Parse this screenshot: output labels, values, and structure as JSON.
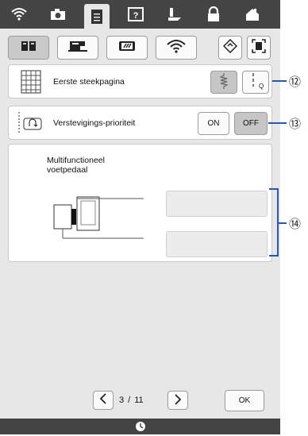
{
  "top_tabs": [
    {
      "icon": "wifi-icon",
      "active": false
    },
    {
      "icon": "camera-icon",
      "active": false
    },
    {
      "icon": "document-icon",
      "active": true
    },
    {
      "icon": "help-icon",
      "active": false
    },
    {
      "icon": "sewing-foot-icon",
      "active": false
    },
    {
      "icon": "lock-icon",
      "active": false
    },
    {
      "icon": "home-icon",
      "active": false
    }
  ],
  "sub_tabs": [
    {
      "icon": "book-icon",
      "selected": true
    },
    {
      "icon": "sewing-machine-icon",
      "selected": false
    },
    {
      "icon": "embroidery-frame-icon",
      "selected": false
    },
    {
      "icon": "wifi-icon",
      "selected": false
    },
    {
      "icon": "diamond-settings-icon",
      "selected": false
    },
    {
      "icon": "scan-frame-icon",
      "selected": false
    }
  ],
  "rows": {
    "first_stitch": {
      "label": "Eerste steekpagina",
      "callout": "⑫"
    },
    "reinforce": {
      "label": "Verstevigings-prioriteit",
      "on": "ON",
      "off": "OFF",
      "callout": "⑬"
    }
  },
  "pedal": {
    "title_line1": "Multifunctioneel",
    "title_line2": "voetpedaal",
    "callout": "⑭"
  },
  "pager": {
    "current": "3",
    "sep": "/",
    "total": "11"
  },
  "ok_label": "OK",
  "colors": {
    "accent_line": "#2e56a8",
    "bar": "#444444"
  }
}
